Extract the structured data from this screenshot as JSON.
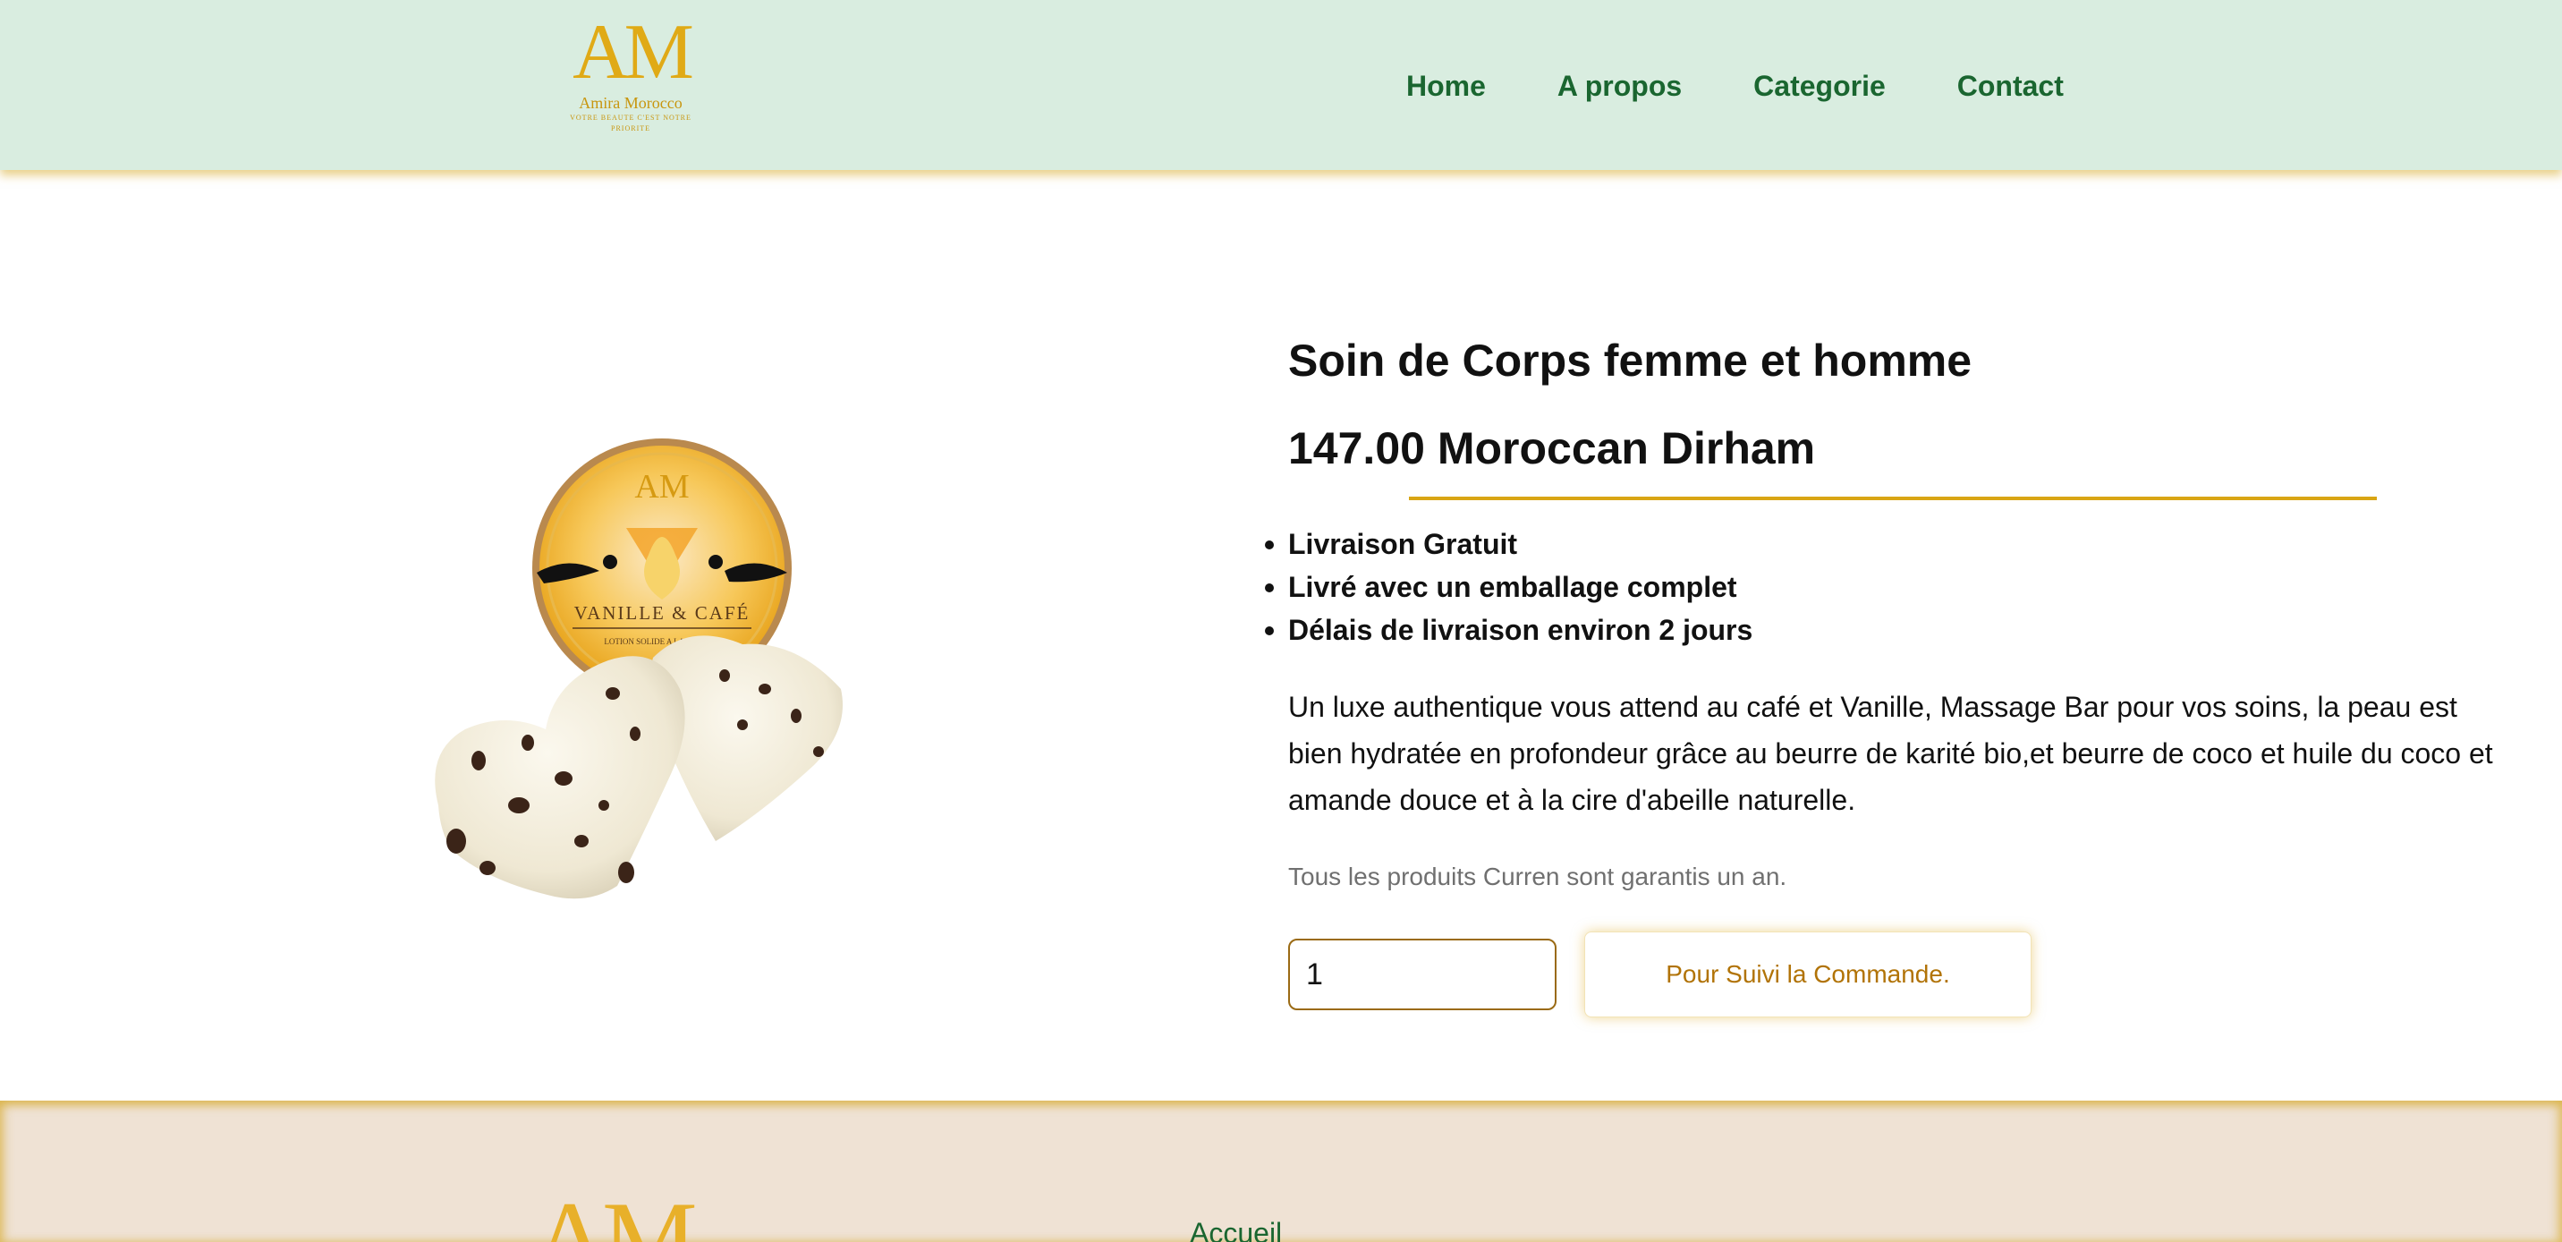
{
  "header": {
    "logo": {
      "monogram": "AM",
      "brand": "Amira Morocco",
      "tagline": "VOTRE BEAUTE C'EST NOTRE PRIORITE"
    },
    "nav": [
      {
        "label": "Home"
      },
      {
        "label": "A propos"
      },
      {
        "label": "Categorie"
      },
      {
        "label": "Contact"
      }
    ]
  },
  "product": {
    "image": {
      "tin_monogram": "AM",
      "tin_label": "VANILLE & CAFÉ",
      "tin_sublabel": "LOTION SOLIDE A LA VANILLE"
    },
    "title": "Soin de Corps femme et homme",
    "price": "147.00 Moroccan Dirham",
    "features": [
      "Livraison Gratuit",
      "Livré avec un emballage complet",
      "Délais de livraison environ 2 jours"
    ],
    "description": "Un luxe authentique vous attend au café et Vanille, Massage Bar pour vos soins, la peau est bien hydratée en profondeur grâce au beurre de karité bio,et beurre de coco et huile du coco et amande douce et à la cire d'abeille naturelle.",
    "guarantee": "Tous les produits Curren sont garantis un an.",
    "quantity": "1",
    "order_button": "Pour Suivi la Commande."
  },
  "footer": {
    "logo_monogram": "AM",
    "links": [
      {
        "label": "Accueil"
      }
    ]
  },
  "colors": {
    "header_bg": "#d9ede0",
    "nav_text": "#1a6630",
    "gold": "#d9a514",
    "button_text": "#b17307",
    "footer_bg": "#efe2d4"
  }
}
